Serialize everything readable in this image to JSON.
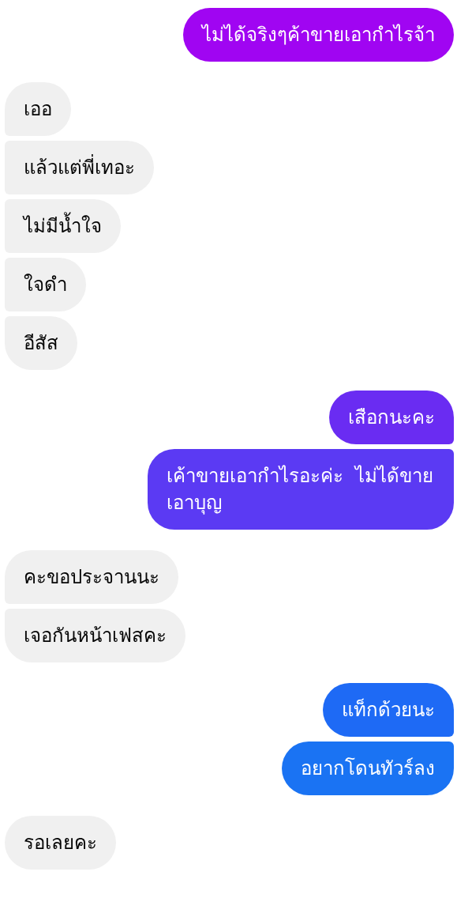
{
  "groups": [
    {
      "kind": "sent",
      "messages": [
        {
          "text": "ไม่ได้จริงๆค้าขายเอากำไรจ้า",
          "color": "#a005f2"
        }
      ]
    },
    {
      "kind": "received",
      "messages": [
        {
          "text": "เออ"
        },
        {
          "text": "แล้วแต่พี่เทอะ"
        },
        {
          "text": "ไม่มีน้ำใจ"
        },
        {
          "text": "ใจดำ"
        },
        {
          "text": "อีสัส"
        }
      ]
    },
    {
      "kind": "sent",
      "messages": [
        {
          "text": "เสือกนะคะ",
          "color": "#6a2cf2"
        },
        {
          "text": "เค้าขายเอากำไรอะค่ะ  ไม่ได้ขายเอาบุญ",
          "color": "#5b3af3"
        }
      ]
    },
    {
      "kind": "received",
      "messages": [
        {
          "text": "คะขอประจานนะ"
        },
        {
          "text": "เจอกันหน้าเฟสคะ"
        }
      ]
    },
    {
      "kind": "sent",
      "messages": [
        {
          "text": "แท็กด้วยนะ",
          "color": "#1e6af5"
        },
        {
          "text": "อยากโดนทัวร์ลง",
          "color": "#1a73f3"
        }
      ]
    },
    {
      "kind": "received",
      "messages": [
        {
          "text": "รอเลยคะ"
        }
      ]
    }
  ]
}
